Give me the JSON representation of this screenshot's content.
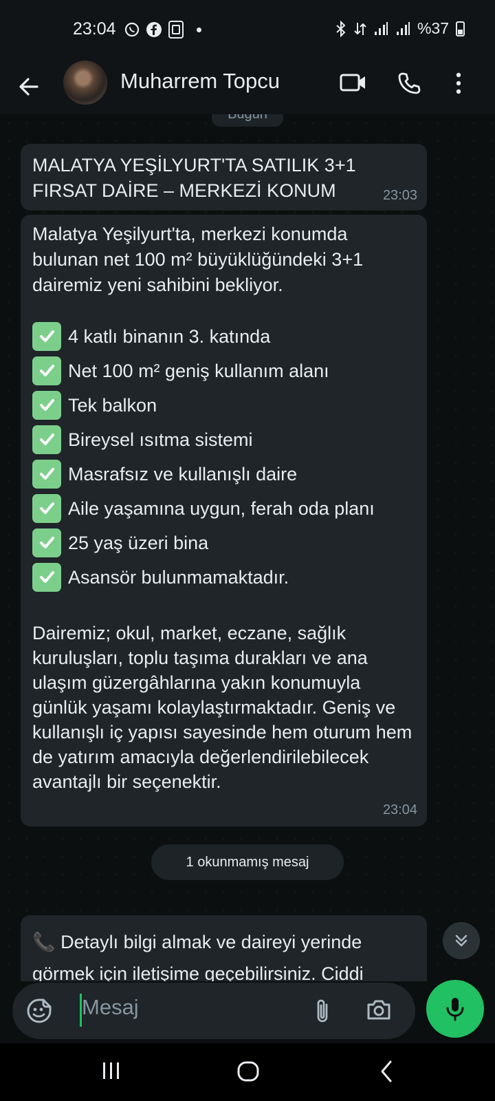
{
  "status_bar": {
    "time": "23:04",
    "battery": "%37",
    "battery_level": 0.37,
    "left_icons": [
      "whatsapp-icon",
      "facebook-icon",
      "screen-mirror-icon",
      "dot"
    ],
    "right_icons": [
      "bluetooth-icon",
      "data-arrows-icon",
      "signal-icon",
      "signal-icon"
    ]
  },
  "header": {
    "contact_name": "Muharrem Topcu",
    "icons": [
      "back-arrow-icon",
      "video-call-icon",
      "phone-icon",
      "more-vert-icon"
    ]
  },
  "chat": {
    "date_label": "Bugün",
    "messages": [
      {
        "text": "MALATYA YEŞİLYURT'TA SATILIK 3+1 FIRSAT DAİRE – MERKEZİ KONUM",
        "time": "23:03"
      },
      {
        "intro": "Malatya Yeşilyurt'ta, merkezi konumda bulunan net 100 m² büyüklüğündeki 3+1 dairemiz yeni sahibini bekliyor.",
        "items": [
          "4 katlı binanın 3. katında",
          "Net 100 m² geniş kullanım alanı",
          "Tek balkon",
          "Bireysel ısıtma sistemi",
          "Masrafsız ve kullanışlı daire",
          "Aile yaşamına uygun, ferah oda planı",
          "25 yaş üzeri bina",
          "Asansör bulunmamaktadır."
        ],
        "outro": "Dairemiz; okul, market, eczane, sağlık kuruluşları, toplu taşıma durakları ve ana ulaşım güzergâhlarına yakın konumuyla günlük yaşamı kolaylaştırmaktadır. Geniş ve kullanışlı iç yapısı sayesinde hem oturum hem de yatırım amacıyla değerlendirilebilecek avantajlı bir seçenektir.",
        "time": "23:04"
      },
      {
        "text": "📞 Detaylı bilgi almak ve daireyi yerinde görmek için iletişime geçebilirsiniz. Ciddi"
      }
    ],
    "unread_label": "1 okunmamış mesaj"
  },
  "composer": {
    "placeholder": "Mesaj",
    "icons": [
      "emoji-icon",
      "attach-icon",
      "camera-icon",
      "mic-icon"
    ]
  },
  "colors": {
    "accent": "#21c063",
    "bubble": "#1f2529",
    "background": "#0b0f10",
    "check": "#7ccf8b"
  }
}
